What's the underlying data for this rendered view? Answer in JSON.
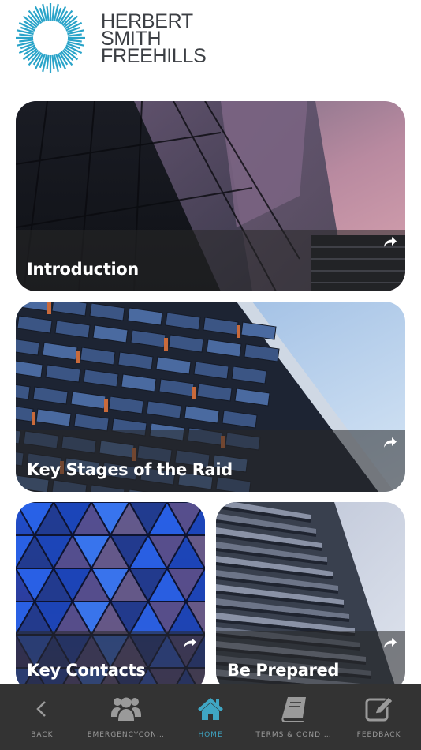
{
  "brand": {
    "name_lines": [
      "HERBERT",
      "SMITH",
      "FREEHILLS"
    ],
    "logo_icon": "sunburst-logo-icon",
    "logo_color": "#2aa4c9",
    "text_color": "#3c3f44"
  },
  "tiles": [
    {
      "title": "Introduction",
      "share_icon": "share-icon"
    },
    {
      "title": "Key Stages of the Raid",
      "share_icon": "share-icon"
    },
    {
      "title": "Key Contacts",
      "share_icon": "share-icon"
    },
    {
      "title": "Be Prepared",
      "share_icon": "share-icon"
    }
  ],
  "bottom_nav": {
    "background": "#333333",
    "active_color": "#3fa6c4",
    "inactive_color": "#9a9a9a",
    "items": [
      {
        "label": "BACK",
        "icon": "chevron-left-icon",
        "active": false
      },
      {
        "label": "EMERGENCYCONT...",
        "icon": "users-icon",
        "active": false
      },
      {
        "label": "HOME",
        "icon": "home-icon",
        "active": true
      },
      {
        "label": "TERMS & CONDITI...",
        "icon": "book-icon",
        "active": false
      },
      {
        "label": "FEEDBACK",
        "icon": "edit-icon",
        "active": false
      }
    ]
  }
}
